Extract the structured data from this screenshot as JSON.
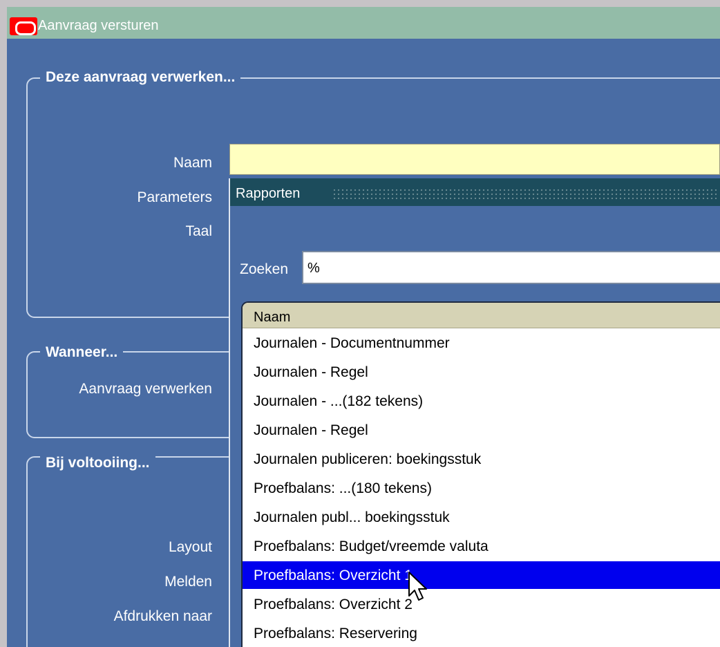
{
  "window": {
    "title": "Aanvraag versturen"
  },
  "group_process": {
    "title": "Deze aanvraag verwerken...",
    "labels": {
      "naam": "Naam",
      "parameters": "Parameters",
      "taal": "Taal"
    }
  },
  "group_when": {
    "title": "Wanneer...",
    "label": "Aanvraag verwerken"
  },
  "group_done": {
    "title": "Bij voltooiing...",
    "labels": {
      "layout": "Layout",
      "melden": "Melden",
      "afdrukken": "Afdrukken naar"
    }
  },
  "popup": {
    "title": "Rapporten",
    "search_label": "Zoeken",
    "search_value": "%",
    "column_header": "Naam",
    "rows": [
      "Journalen - Documentnummer",
      "Journalen - Regel",
      "Journalen - ...(182 tekens)",
      "Journalen - Regel",
      "Journalen publiceren: boekingsstuk",
      "Proefbalans: ...(180 tekens)",
      "Journalen publ... boekingsstuk",
      "Proefbalans: Budget/vreemde valuta",
      "Proefbalans: Overzicht 1",
      "Proefbalans: Overzicht 2",
      "Proefbalans: Reservering"
    ],
    "selected_index": 8
  },
  "colors": {
    "window_bg": "#496ca4",
    "titlebar_bg": "#93bca8",
    "popup_titlebar_bg": "#1c4c5c",
    "selection": "#0000ee",
    "input_bg": "#ffffc0"
  }
}
